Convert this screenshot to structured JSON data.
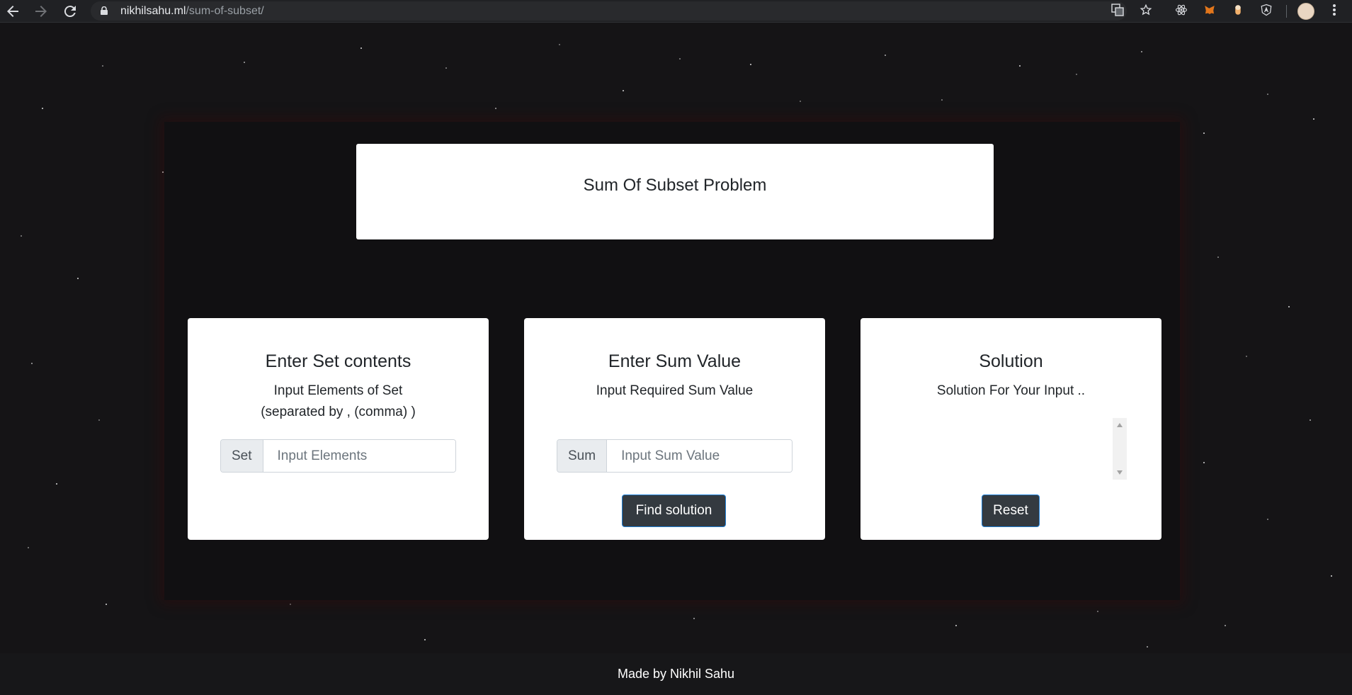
{
  "browser": {
    "url_host": "nikhilsahu.ml",
    "url_path": "/sum-of-subset/"
  },
  "page": {
    "title": "Sum Of Subset Problem",
    "set_card": {
      "heading": "Enter Set contents",
      "desc_line1": "Input Elements of Set",
      "desc_line2": "(separated by , (comma) )",
      "addon": "Set",
      "placeholder": "Input Elements",
      "value": ""
    },
    "sum_card": {
      "heading": "Enter Sum Value",
      "desc": "Input Required Sum Value",
      "addon": "Sum",
      "placeholder": "Input Sum Value",
      "value": "",
      "button": "Find solution"
    },
    "solution_card": {
      "heading": "Solution",
      "desc": "Solution For Your Input ..",
      "output": "",
      "button": "Reset"
    },
    "footer": "Made by Nikhil Sahu"
  },
  "colors": {
    "background": "#151416",
    "card": "#ffffff",
    "button": "#343a40",
    "button_border": "#1f7fd6",
    "addon": "#e9ecef"
  },
  "icons": [
    "back-arrow-icon",
    "forward-arrow-icon",
    "reload-icon",
    "lock-icon",
    "translate-icon",
    "star-icon",
    "react-devtools-icon",
    "metamask-icon",
    "extension-icon",
    "angular-icon",
    "profile-avatar",
    "menu-icon"
  ]
}
